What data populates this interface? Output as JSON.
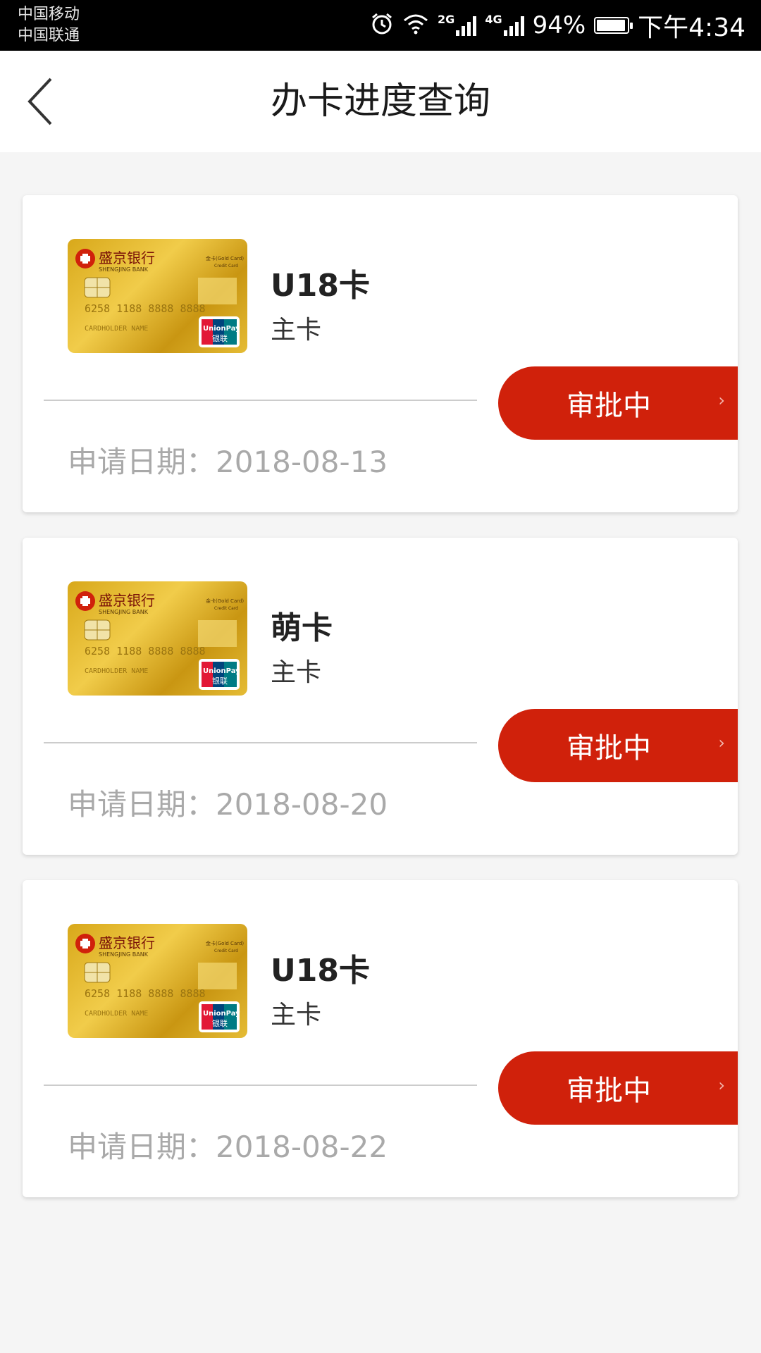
{
  "status_bar": {
    "carrier1": "中国移动",
    "carrier2": "中国联通",
    "net1": "2G",
    "net2": "4G",
    "battery_pct": "94%",
    "battery_level": 0.94,
    "time": "下午4:34"
  },
  "header": {
    "title": "办卡进度查询",
    "back_icon": "chevron-left-icon"
  },
  "colors": {
    "accent": "#d0210b",
    "card_gold": "#d8a81a"
  },
  "applications": [
    {
      "card_name": "U18卡",
      "card_type": "主卡",
      "status": "审批中",
      "date_label": "申请日期：2018-08-13"
    },
    {
      "card_name": "萌卡",
      "card_type": "主卡",
      "status": "审批中",
      "date_label": "申请日期：2018-08-20"
    },
    {
      "card_name": "U18卡",
      "card_type": "主卡",
      "status": "审批中",
      "date_label": "申请日期：2018-08-22"
    }
  ],
  "card_art": {
    "bank_cn": "盛京银行",
    "bank_en": "SHENGJING BANK",
    "tier": "金卡(Gold Card)",
    "tier_sub": "Credit Card",
    "number": "6258 1188 8888 8888",
    "holder": "CARDHOLDER NAME",
    "network": "UnionPay",
    "network_cn": "银联"
  }
}
